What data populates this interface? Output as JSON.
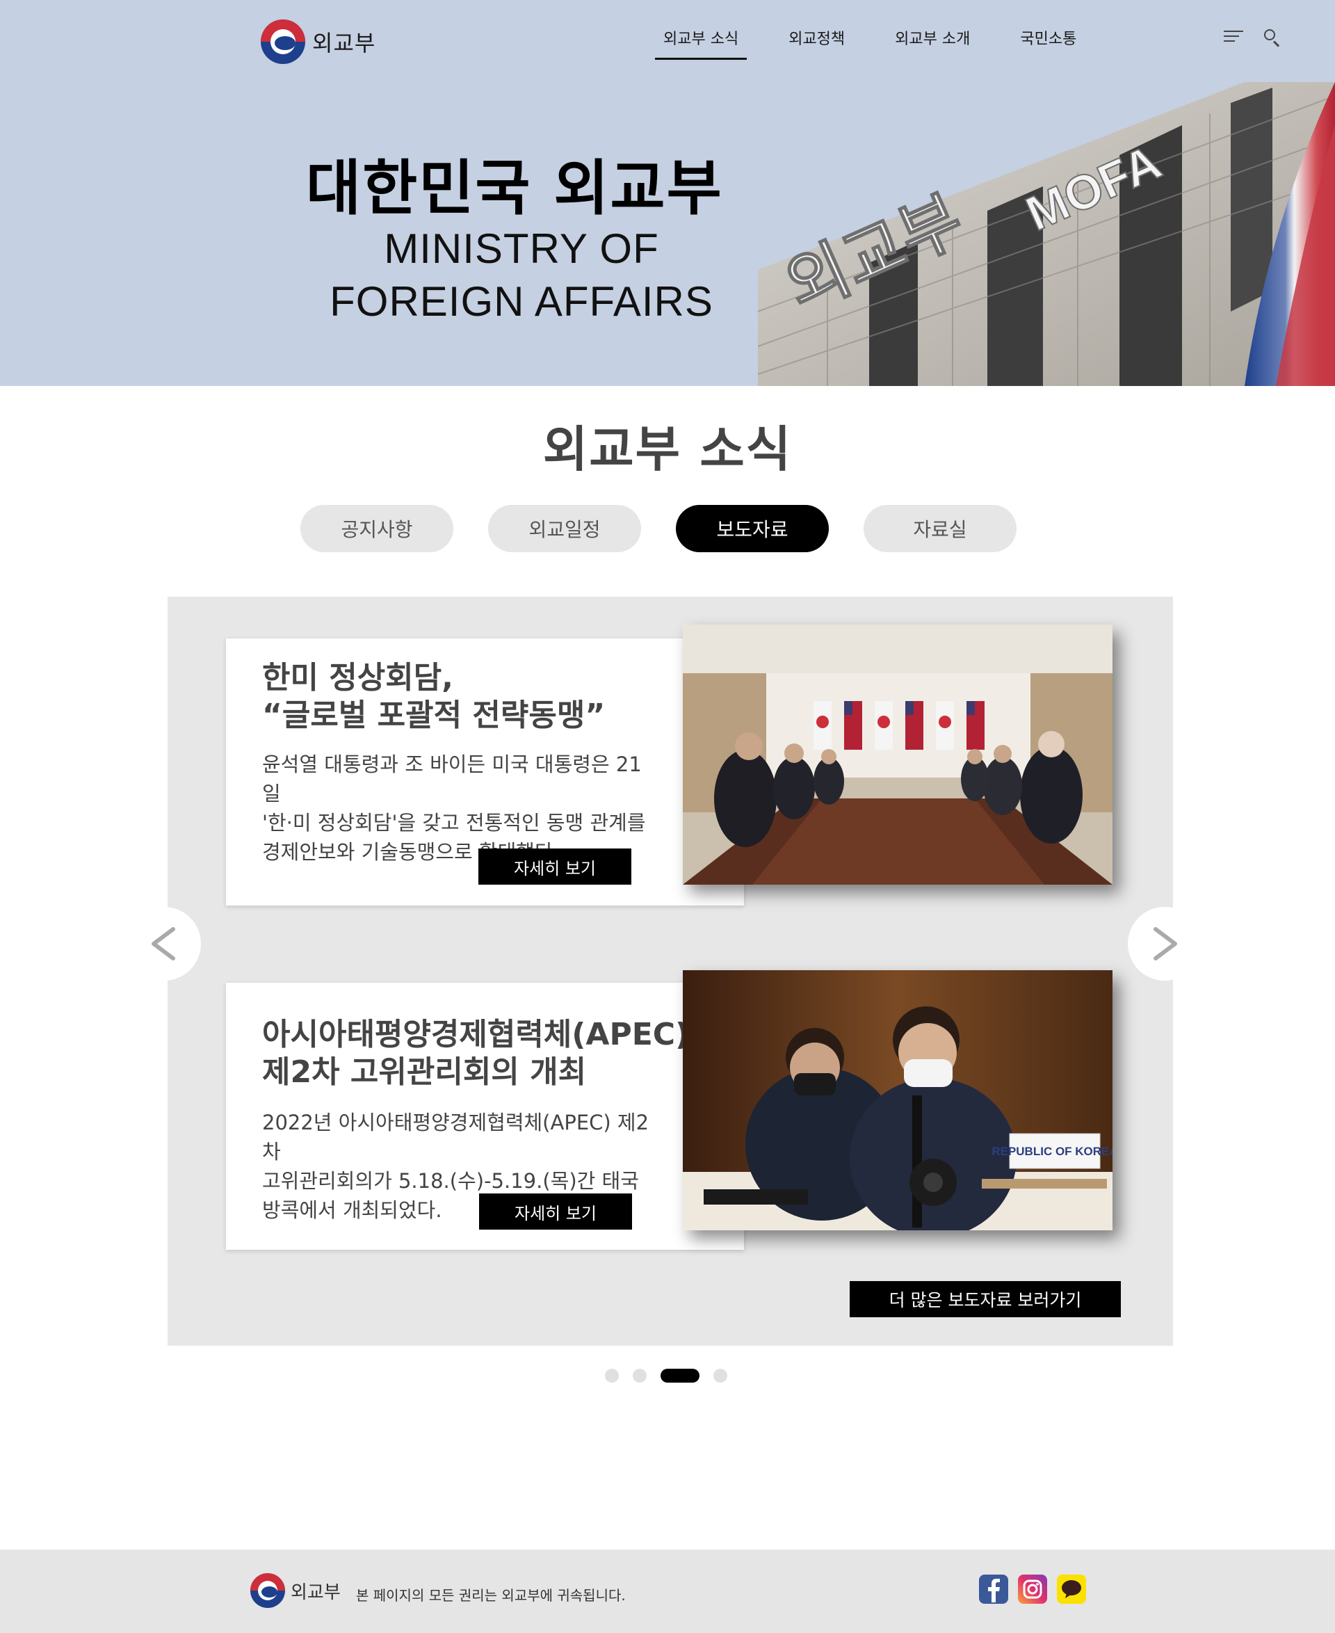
{
  "header": {
    "logo_text": "외교부",
    "nav": [
      {
        "label": "외교부 소식",
        "active": true
      },
      {
        "label": "외교정책",
        "active": false
      },
      {
        "label": "외교부 소개",
        "active": false
      },
      {
        "label": "국민소통",
        "active": false
      }
    ],
    "icons": [
      "menu-icon",
      "search-icon"
    ]
  },
  "hero": {
    "title_ko": "대한민국 외교부",
    "title_en_line1": "MINISTRY OF",
    "title_en_line2": "FOREIGN AFFAIRS",
    "building_sign_ko": "외교부",
    "building_sign_en": "MOFA"
  },
  "news": {
    "section_title": "외교부 소식",
    "tabs": [
      {
        "label": "공지사항",
        "active": false
      },
      {
        "label": "외교일정",
        "active": false
      },
      {
        "label": "보도자료",
        "active": true
      },
      {
        "label": "자료실",
        "active": false
      }
    ],
    "cards": [
      {
        "title_line1": "한미 정상회담,",
        "title_line2": "“글로벌 포괄적 전략동맹”",
        "desc_line1": "윤석열 대통령과 조 바이든 미국 대통령은 21일",
        "desc_line2": "'한·미 정상회담'을 갖고 전통적인 동맹 관계를",
        "desc_line3": "경제안보와 기술동맹으로 확대했다.",
        "button": "자세히 보기"
      },
      {
        "title_line1": "아시아태평양경제협력체(APEC)",
        "title_line2": "제2차 고위관리회의 개최",
        "desc_line1": "2022년 아시아태평양경제협력체(APEC) 제2차",
        "desc_line2": "고위관리회의가 5.18.(수)-5.19.(목)간 태국",
        "desc_line3": "방콕에서 개최되었다.",
        "button": "자세히 보기",
        "photo_sign": "REPUBLIC OF KOREA"
      }
    ],
    "more_button": "더 많은 보도자료 보러가기",
    "pagination": {
      "total": 4,
      "active_index": 2
    }
  },
  "footer": {
    "logo_text": "외교부",
    "copyright": "본 페이지의 모든 권리는 외교부에 귀속됩니다.",
    "sns": [
      "facebook-icon",
      "instagram-icon",
      "kakaotalk-icon"
    ]
  },
  "colors": {
    "hero_bg": "#c5d0e2",
    "panel_bg": "#e7e7e7",
    "accent": "#000000",
    "footer_bg": "#e5e5e5"
  }
}
